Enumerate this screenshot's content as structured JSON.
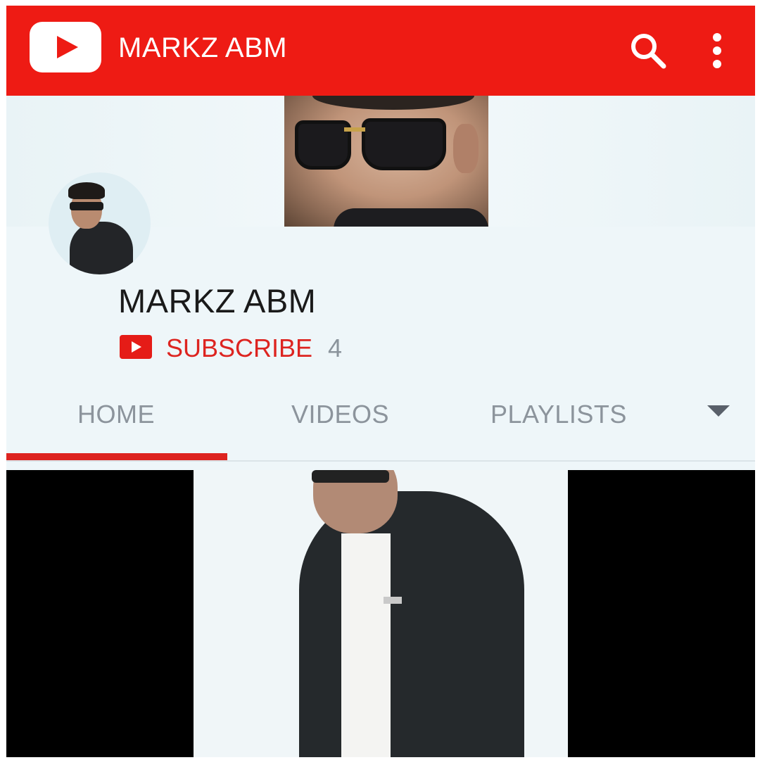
{
  "app_bar": {
    "title": "MARKZ ABM",
    "color": "#ee1b14",
    "logo_icon": "youtube-play-icon",
    "search_icon": "search-icon",
    "more_icon": "more-vert-icon"
  },
  "channel": {
    "name": "MARKZ ABM",
    "subscribe_label": "SUBSCRIBE",
    "subscriber_count": "4",
    "subscribe_color": "#dd2420"
  },
  "tabs": {
    "items": [
      {
        "label": "HOME",
        "active": true
      },
      {
        "label": "VIDEOS",
        "active": false
      },
      {
        "label": "PLAYLISTS",
        "active": false
      }
    ],
    "more_icon": "dropdown-triangle-icon"
  }
}
